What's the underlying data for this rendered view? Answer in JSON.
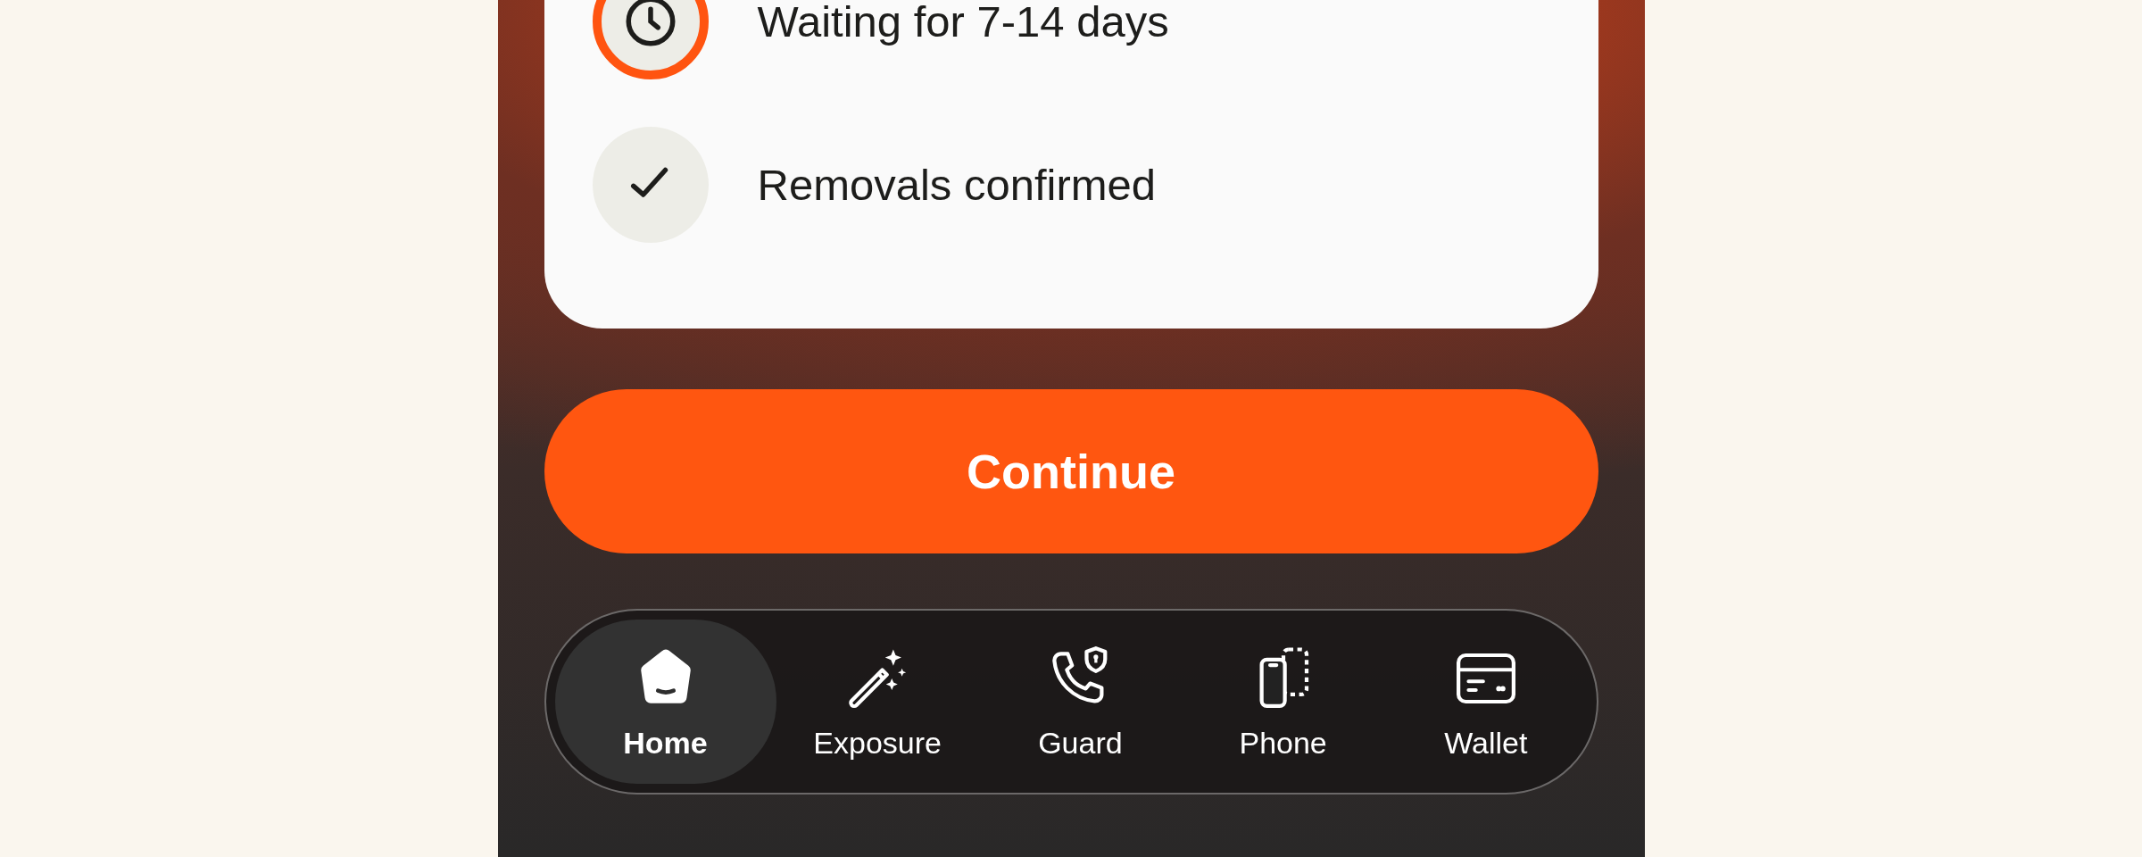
{
  "steps": [
    {
      "kind": "clock",
      "label": "Waiting for 7-14 days",
      "active": true
    },
    {
      "kind": "check",
      "label": "Removals confirmed",
      "active": false
    }
  ],
  "continue_button": {
    "label": "Continue"
  },
  "tab_bar": [
    {
      "kind": "home",
      "label": "Home",
      "selected": true
    },
    {
      "kind": "wand",
      "label": "Exposure",
      "selected": false
    },
    {
      "kind": "call-shield",
      "label": "Guard",
      "selected": false
    },
    {
      "kind": "devices",
      "label": "Phone",
      "selected": false
    },
    {
      "kind": "card",
      "label": "Wallet",
      "selected": false
    }
  ]
}
